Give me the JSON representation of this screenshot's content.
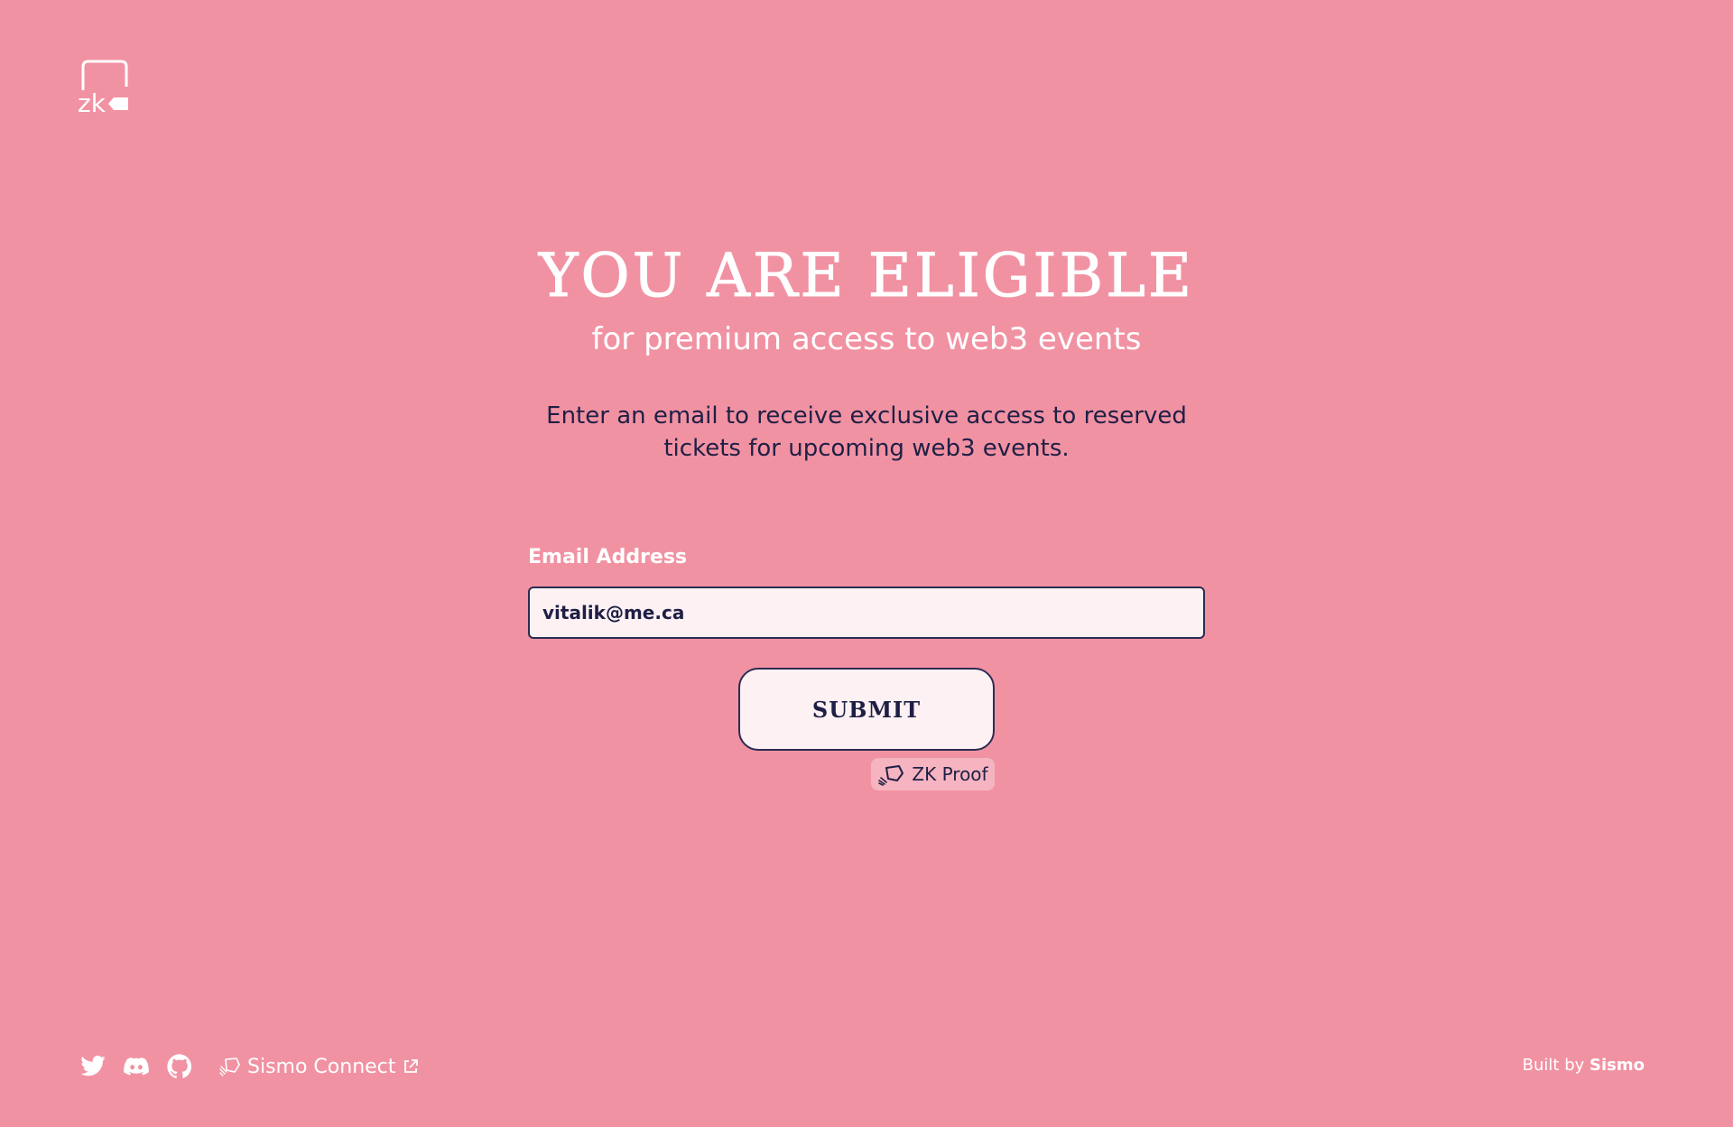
{
  "logo": {
    "text": "zk",
    "icon": "zk-logo-icon"
  },
  "hero": {
    "title": "YOU ARE ELIGIBLE",
    "subtitle": "for premium access to web3 events"
  },
  "description": {
    "line1": "Enter an email to receive exclusive access to reserved",
    "line2": "tickets for upcoming web3 events."
  },
  "form": {
    "email_label": "Email Address",
    "email_value": "vitalik@me.ca",
    "submit_label": "SUBMIT"
  },
  "zk_badge": {
    "label": "ZK Proof",
    "icon": "zk-proof-icon"
  },
  "footer": {
    "social": [
      {
        "name": "twitter",
        "icon": "twitter-icon"
      },
      {
        "name": "discord",
        "icon": "discord-icon"
      },
      {
        "name": "github",
        "icon": "github-icon"
      }
    ],
    "connect_label": "Sismo Connect",
    "built_by_prefix": "Built by",
    "built_by_brand": "Sismo"
  },
  "colors": {
    "background": "#f192a3",
    "text_dark": "#1f1f45",
    "input_bg": "#fdf1f4",
    "border": "#2c2c52"
  }
}
